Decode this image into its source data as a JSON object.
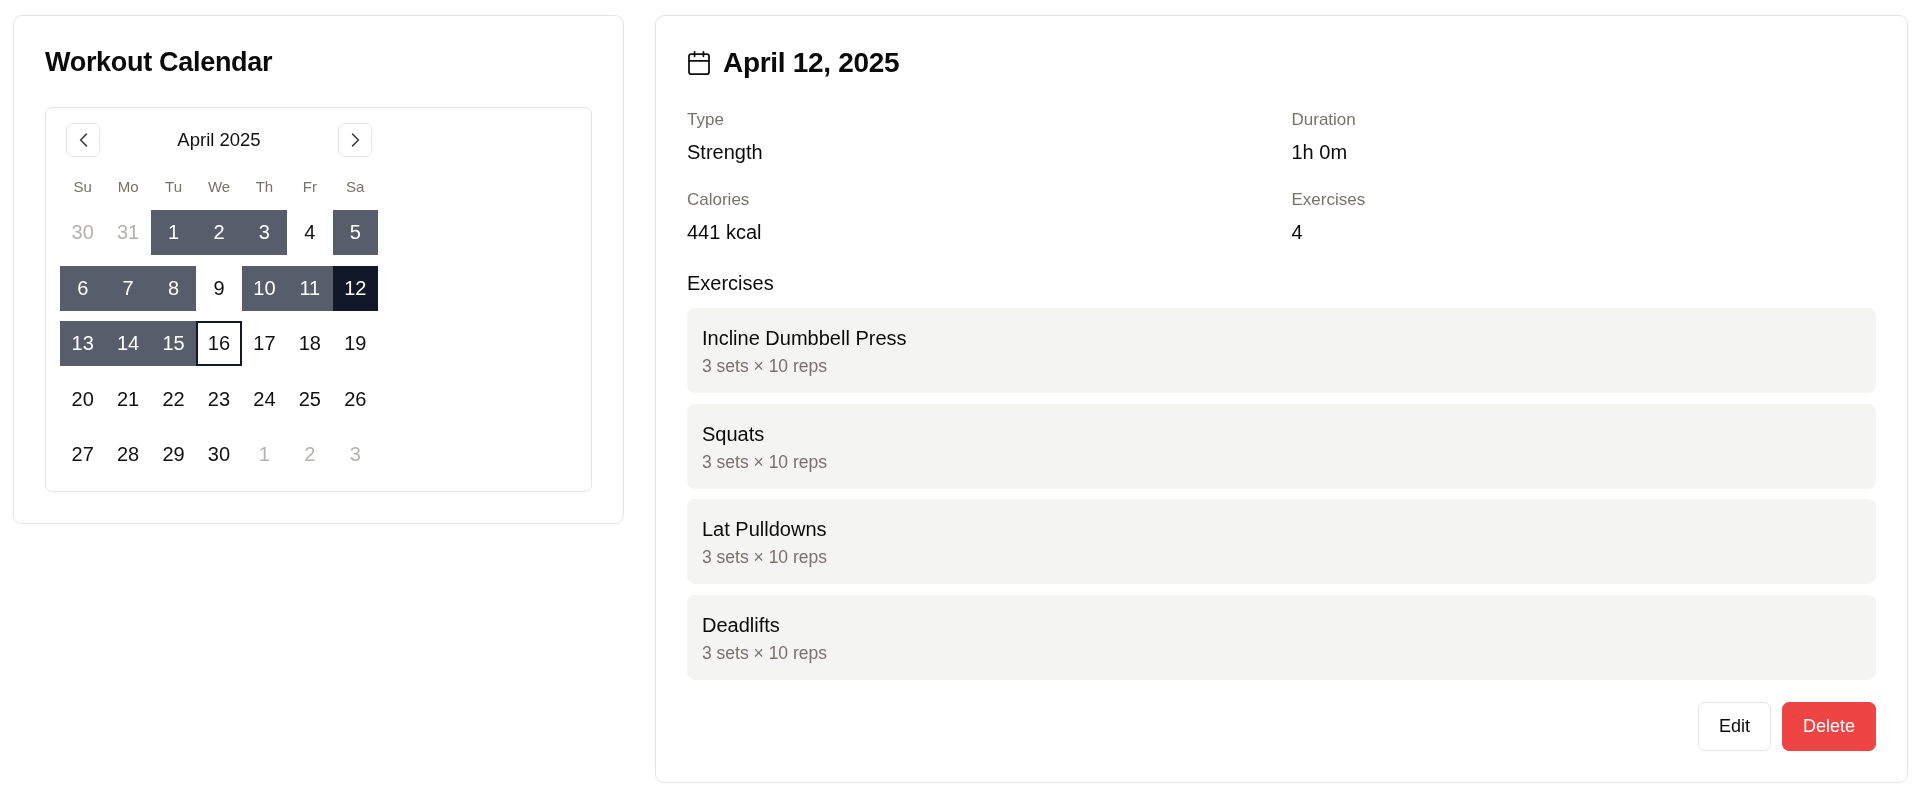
{
  "calendar_card": {
    "title": "Workout Calendar"
  },
  "calendar": {
    "month": "April 2025",
    "weekdays": [
      "Su",
      "Mo",
      "Tu",
      "We",
      "Th",
      "Fr",
      "Sa"
    ],
    "weeks": [
      [
        {
          "day": "30",
          "outside": true,
          "workout": false,
          "selected": false,
          "today": false
        },
        {
          "day": "31",
          "outside": true,
          "workout": false,
          "selected": false,
          "today": false
        },
        {
          "day": "1",
          "outside": false,
          "workout": true,
          "selected": false,
          "today": false
        },
        {
          "day": "2",
          "outside": false,
          "workout": true,
          "selected": false,
          "today": false
        },
        {
          "day": "3",
          "outside": false,
          "workout": true,
          "selected": false,
          "today": false
        },
        {
          "day": "4",
          "outside": false,
          "workout": false,
          "selected": false,
          "today": false
        },
        {
          "day": "5",
          "outside": false,
          "workout": true,
          "selected": false,
          "today": false
        }
      ],
      [
        {
          "day": "6",
          "outside": false,
          "workout": true,
          "selected": false,
          "today": false
        },
        {
          "day": "7",
          "outside": false,
          "workout": true,
          "selected": false,
          "today": false
        },
        {
          "day": "8",
          "outside": false,
          "workout": true,
          "selected": false,
          "today": false
        },
        {
          "day": "9",
          "outside": false,
          "workout": false,
          "selected": false,
          "today": false
        },
        {
          "day": "10",
          "outside": false,
          "workout": true,
          "selected": false,
          "today": false
        },
        {
          "day": "11",
          "outside": false,
          "workout": true,
          "selected": false,
          "today": false
        },
        {
          "day": "12",
          "outside": false,
          "workout": true,
          "selected": true,
          "today": false
        }
      ],
      [
        {
          "day": "13",
          "outside": false,
          "workout": true,
          "selected": false,
          "today": false
        },
        {
          "day": "14",
          "outside": false,
          "workout": true,
          "selected": false,
          "today": false
        },
        {
          "day": "15",
          "outside": false,
          "workout": true,
          "selected": false,
          "today": false
        },
        {
          "day": "16",
          "outside": false,
          "workout": false,
          "selected": false,
          "today": true
        },
        {
          "day": "17",
          "outside": false,
          "workout": false,
          "selected": false,
          "today": false
        },
        {
          "day": "18",
          "outside": false,
          "workout": false,
          "selected": false,
          "today": false
        },
        {
          "day": "19",
          "outside": false,
          "workout": false,
          "selected": false,
          "today": false
        }
      ],
      [
        {
          "day": "20",
          "outside": false,
          "workout": false,
          "selected": false,
          "today": false
        },
        {
          "day": "21",
          "outside": false,
          "workout": false,
          "selected": false,
          "today": false
        },
        {
          "day": "22",
          "outside": false,
          "workout": false,
          "selected": false,
          "today": false
        },
        {
          "day": "23",
          "outside": false,
          "workout": false,
          "selected": false,
          "today": false
        },
        {
          "day": "24",
          "outside": false,
          "workout": false,
          "selected": false,
          "today": false
        },
        {
          "day": "25",
          "outside": false,
          "workout": false,
          "selected": false,
          "today": false
        },
        {
          "day": "26",
          "outside": false,
          "workout": false,
          "selected": false,
          "today": false
        }
      ],
      [
        {
          "day": "27",
          "outside": false,
          "workout": false,
          "selected": false,
          "today": false
        },
        {
          "day": "28",
          "outside": false,
          "workout": false,
          "selected": false,
          "today": false
        },
        {
          "day": "29",
          "outside": false,
          "workout": false,
          "selected": false,
          "today": false
        },
        {
          "day": "30",
          "outside": false,
          "workout": false,
          "selected": false,
          "today": false
        },
        {
          "day": "1",
          "outside": true,
          "workout": false,
          "selected": false,
          "today": false
        },
        {
          "day": "2",
          "outside": true,
          "workout": false,
          "selected": false,
          "today": false
        },
        {
          "day": "3",
          "outside": true,
          "workout": false,
          "selected": false,
          "today": false
        }
      ]
    ]
  },
  "details": {
    "date": "April 12, 2025",
    "stats": [
      {
        "label": "Type",
        "value": "Strength"
      },
      {
        "label": "Duration",
        "value": "1h 0m"
      },
      {
        "label": "Calories",
        "value": "441 kcal"
      },
      {
        "label": "Exercises",
        "value": "4"
      }
    ],
    "exercises_heading": "Exercises",
    "exercises": [
      {
        "name": "Incline Dumbbell Press",
        "detail": "3 sets × 10 reps"
      },
      {
        "name": "Squats",
        "detail": "3 sets × 10 reps"
      },
      {
        "name": "Lat Pulldowns",
        "detail": "3 sets × 10 reps"
      },
      {
        "name": "Deadlifts",
        "detail": "3 sets × 10 reps"
      }
    ],
    "actions": [
      {
        "label": "Edit",
        "kind": "secondary"
      },
      {
        "label": "Delete",
        "kind": "danger"
      }
    ]
  }
}
